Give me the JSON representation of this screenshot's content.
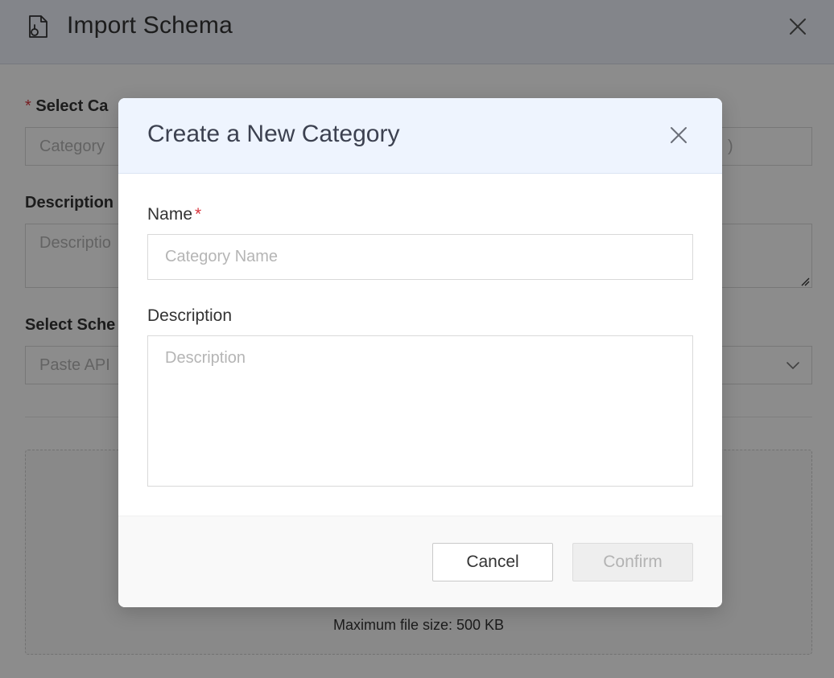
{
  "drawer": {
    "title": "Import Schema",
    "icon": "file-icon",
    "category_label": "Select Ca",
    "category_placeholder": "Category",
    "category_right_fragment": ")",
    "description_label": "Description",
    "description_placeholder": "Descriptio",
    "schema_label": "Select Sche",
    "schema_placeholder": "Paste API",
    "dropzone_hint": "Maximum file size: 500 KB"
  },
  "modal": {
    "title": "Create a New Category",
    "name_label": "Name",
    "required_mark": "*",
    "name_placeholder": "Category Name",
    "name_value": "",
    "description_label": "Description",
    "description_placeholder": "Description",
    "description_value": "",
    "cancel_label": "Cancel",
    "confirm_label": "Confirm",
    "confirm_disabled": true
  },
  "colors": {
    "required": "#d9363e",
    "header_bg": "#eef4fe",
    "overlay": "rgba(0,0,0,0.45)"
  }
}
